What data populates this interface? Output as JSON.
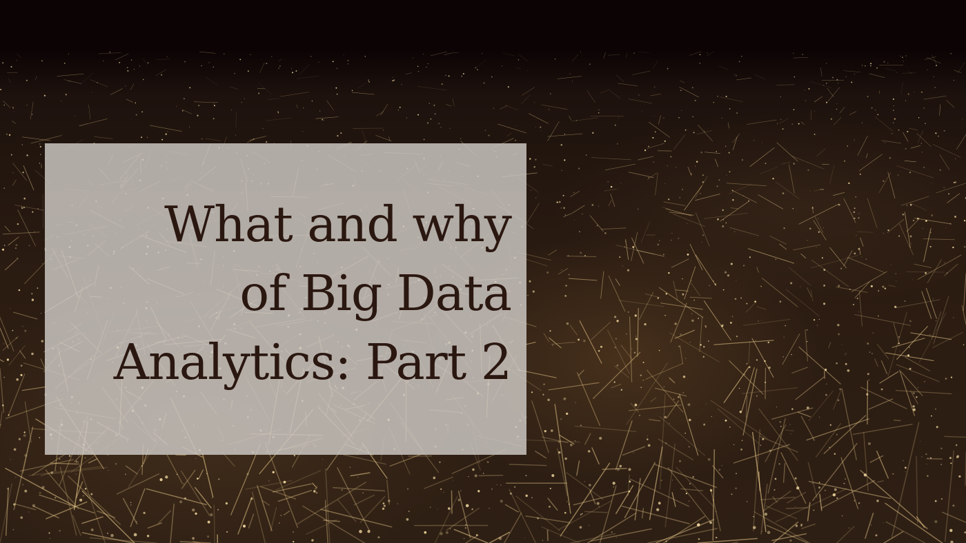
{
  "headline": {
    "line1": "What and why",
    "line2": "of Big Data",
    "line3": "Analytics: Part 2"
  },
  "colors": {
    "sky": "#0b0304",
    "ground": "#2e1f14",
    "lights": "#e8c98a",
    "panel": "#cdc8c4",
    "text": "#2a1710"
  }
}
